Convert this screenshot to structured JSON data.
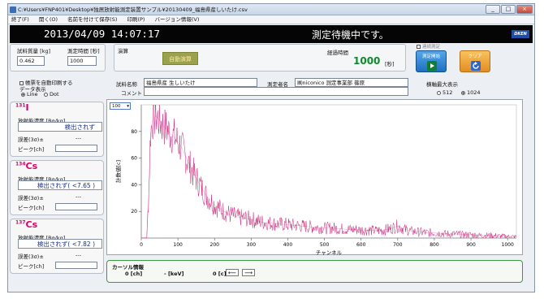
{
  "window": {
    "title": "C:¥Users¥FNP401¥Desktop¥独居放射能測定装置サンプル¥20130409_福島県産しいたけ.csv",
    "controls": [
      "_",
      "□",
      "×"
    ]
  },
  "menu": [
    "終了(F)",
    "開く(O)",
    "名前を付けて保存(S)",
    "印刷(P)",
    "バージョン情報(V)"
  ],
  "header": {
    "datetime": "2013/04/09 14:07:17",
    "status": "測定待機中です。",
    "logo": "DKEN"
  },
  "sample": {
    "mass_label": "試料質量 [kg]",
    "mass_value": "0.462",
    "time_label": "測定時間 [秒]",
    "time_value": "1000"
  },
  "calc": {
    "label": "演算",
    "auto_button": "自動演算"
  },
  "elapsed": {
    "label": "経過時間",
    "value": "1000",
    "unit": "[秒]"
  },
  "continuous_label": "連続測定",
  "buttons": {
    "start": "測定開始",
    "clear": "クリア"
  },
  "options": {
    "auto_print": "帳票を自動印刷する",
    "data_display": "データ表示",
    "line": "Line",
    "dot": "Dot",
    "line_selected": true
  },
  "info": {
    "sample_name_label": "試料名称",
    "sample_name": "福島県産 生しいたけ",
    "operator_label": "測定者名",
    "operator": "㈱niconico 測定事業部 篠原",
    "comment_label": "コメント",
    "comment": ""
  },
  "axis_max": {
    "label": "横軸最大表示",
    "opt1": "512",
    "opt2": "1024",
    "selected": "1024"
  },
  "nuclides": [
    {
      "mass": "131",
      "symbol": "I",
      "conc_label": "放射能濃度 [Bq/kg]",
      "result": "検出されず",
      "error_label": "誤差(3σ)±",
      "error": "---",
      "peak_label": "ピーク[ch]",
      "peak": ""
    },
    {
      "mass": "134",
      "symbol": "Cs",
      "conc_label": "放射能濃度 [Bq/kg]",
      "result": "検出されず( <7.65 )",
      "error_label": "誤差(3σ)±",
      "error": "---",
      "peak_label": "ピーク[ch]",
      "peak": ""
    },
    {
      "mass": "137",
      "symbol": "Cs",
      "conc_label": "放射能濃度 [Bq/kg]",
      "result": "検出されず( <7.82 )",
      "error_label": "誤差(3σ)±",
      "error": "---",
      "peak_label": "ピーク[ch]",
      "peak": ""
    }
  ],
  "scale_select": "100",
  "cursor": {
    "label": "カーソル情報",
    "ch": "0 [ch]",
    "kev": "- [keV]",
    "c": "0 [c]",
    "left": "⟵",
    "right": "⟶"
  },
  "chart_data": {
    "type": "line",
    "xlabel": "チャンネル",
    "ylabel": "計数値[c]",
    "xlim": [
      0,
      1024
    ],
    "ylim": [
      0,
      100
    ],
    "xticks": [
      0,
      100,
      200,
      300,
      400,
      500,
      600,
      700,
      800,
      900,
      1000
    ],
    "yticks": [
      20,
      40,
      60,
      80
    ],
    "color": "#c8287a",
    "series": [
      {
        "x": [
          0,
          15,
          20,
          25,
          30,
          40,
          50,
          60,
          70,
          80,
          90,
          100,
          110,
          120,
          130,
          140,
          150,
          160,
          170,
          180,
          190,
          200,
          220,
          240,
          260,
          280,
          300,
          320,
          340,
          360,
          380,
          400,
          420,
          440,
          460,
          480,
          500,
          520,
          540,
          560,
          580,
          600,
          620,
          640,
          660,
          680,
          700,
          720,
          740,
          760,
          780,
          800,
          820,
          840,
          860,
          880,
          900,
          920,
          940,
          960,
          980,
          1000,
          1024
        ],
        "y": [
          0,
          0,
          30,
          78,
          88,
          92,
          88,
          84,
          82,
          78,
          76,
          72,
          68,
          62,
          56,
          50,
          45,
          40,
          35,
          31,
          28,
          25,
          21,
          18,
          16,
          15,
          14,
          12.5,
          11.5,
          11,
          10.5,
          10,
          9.5,
          9,
          8.5,
          8,
          7.5,
          7.5,
          7,
          6.5,
          6.5,
          6,
          6,
          5.5,
          6,
          7,
          9,
          6.5,
          5,
          4.5,
          4,
          4,
          3.5,
          3,
          3,
          2.5,
          2.5,
          2,
          2,
          1.8,
          1.5,
          1.2,
          1
        ]
      }
    ]
  }
}
